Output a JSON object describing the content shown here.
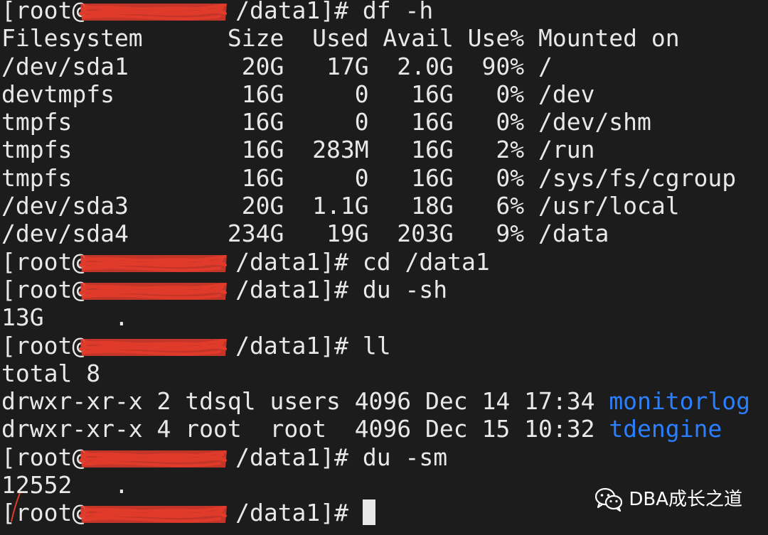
{
  "terminal": {
    "background": "#1c1c1c",
    "foreground": "#e8e8e8",
    "link_color": "#2a7fff",
    "redaction_color": "#e03a2a",
    "prompt_user": "[root@",
    "prompt_suffix": " /data1]# ",
    "lines": [
      {
        "type": "prompt",
        "cmd": "df -h"
      },
      {
        "type": "text",
        "text": "Filesystem      Size  Used Avail Use% Mounted on"
      },
      {
        "type": "text",
        "text": "/dev/sda1        20G   17G  2.0G  90% /"
      },
      {
        "type": "text",
        "text": "devtmpfs         16G     0   16G   0% /dev"
      },
      {
        "type": "text",
        "text": "tmpfs            16G     0   16G   0% /dev/shm"
      },
      {
        "type": "text",
        "text": "tmpfs            16G  283M   16G   2% /run"
      },
      {
        "type": "text",
        "text": "tmpfs            16G     0   16G   0% /sys/fs/cgroup"
      },
      {
        "type": "text",
        "text": "/dev/sda3        20G  1.1G   18G   6% /usr/local"
      },
      {
        "type": "text",
        "text": "/dev/sda4       234G   19G  203G   9% /data"
      },
      {
        "type": "prompt",
        "cmd": "cd /data1"
      },
      {
        "type": "prompt",
        "cmd": "du -sh"
      },
      {
        "type": "text",
        "text": "13G     ."
      },
      {
        "type": "prompt",
        "cmd": "ll"
      },
      {
        "type": "text",
        "text": "total 8"
      },
      {
        "type": "listing",
        "text": "drwxr-xr-x 2 tdsql users 4096 Dec 14 17:34 ",
        "name": "monitorlog"
      },
      {
        "type": "listing",
        "text": "drwxr-xr-x 4 root  root  4096 Dec 15 10:32 ",
        "name": "tdengine"
      },
      {
        "type": "prompt",
        "cmd": "du -sm"
      },
      {
        "type": "text",
        "text": "12552   ."
      },
      {
        "type": "prompt",
        "cmd": "",
        "cursor": true
      }
    ]
  },
  "watermark": {
    "icon": "wechat-icon",
    "text": "DBA成长之道"
  }
}
